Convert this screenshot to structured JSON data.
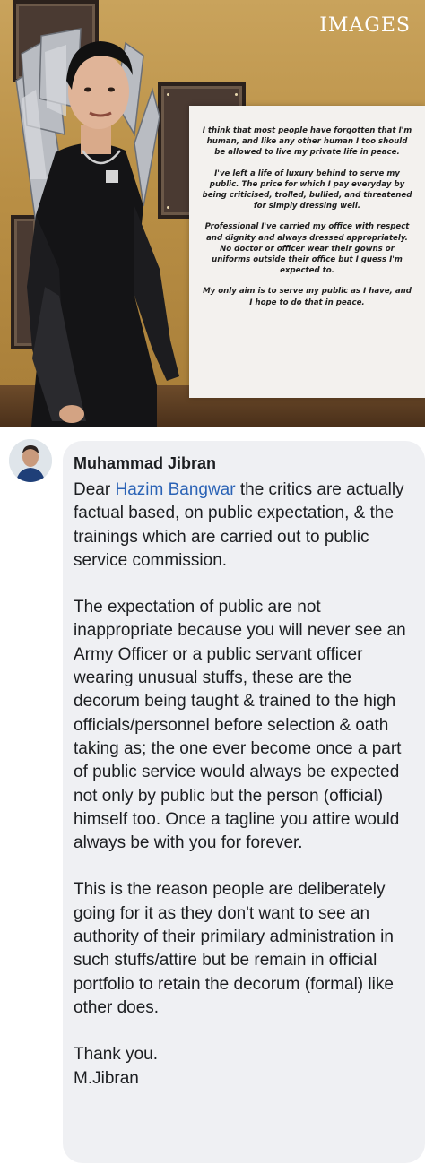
{
  "post_image": {
    "brand_logo": "IMAGES",
    "quote_paragraphs": [
      "I think that most people have forgotten that I'm human, and like any other human I too should be allowed to live my private life in peace.",
      "I've left a life of luxury behind to serve my public. The price for which I pay everyday by being criticised, trolled, bullied, and threatened for simply dressing well.",
      "Professional I've carried my office with respect and dignity and always dressed appropriately.\nNo doctor or officer wear their gowns or uniforms outside their office but I guess I'm expected to.",
      "My only aim is to serve my public as I have, and I hope to do that in peace."
    ]
  },
  "comment": {
    "author": "Muhammad Jibran",
    "greeting_prefix": "Dear ",
    "mention": "Hazim Bangwar",
    "paragraph1_rest": " the critics are actually factual based, on public expectation, & the trainings which are carried out to public service commission.",
    "paragraph2": "The expectation of public are not inappropriate because you will never see an Army Officer or a public servant officer wearing unusual stuffs, these are the decorum being taught & trained to the high officials/personnel before selection & oath taking as; the one ever become once a part of public service would always be expected not only by public but the person (official) himself too. Once a tagline you attire would always be with you for forever.",
    "paragraph3": "This is the reason people are deliberately going for it as they don't want to see an authority of their primilary administration in such stuffs/attire but be remain in official portfolio to retain the decorum (formal) like other does.",
    "signoff_line1": "Thank you.",
    "signoff_line2": "M.Jibran"
  },
  "colors": {
    "mention": "#2a62b5",
    "bubble": "#eff0f3",
    "text": "#1c1e21"
  }
}
